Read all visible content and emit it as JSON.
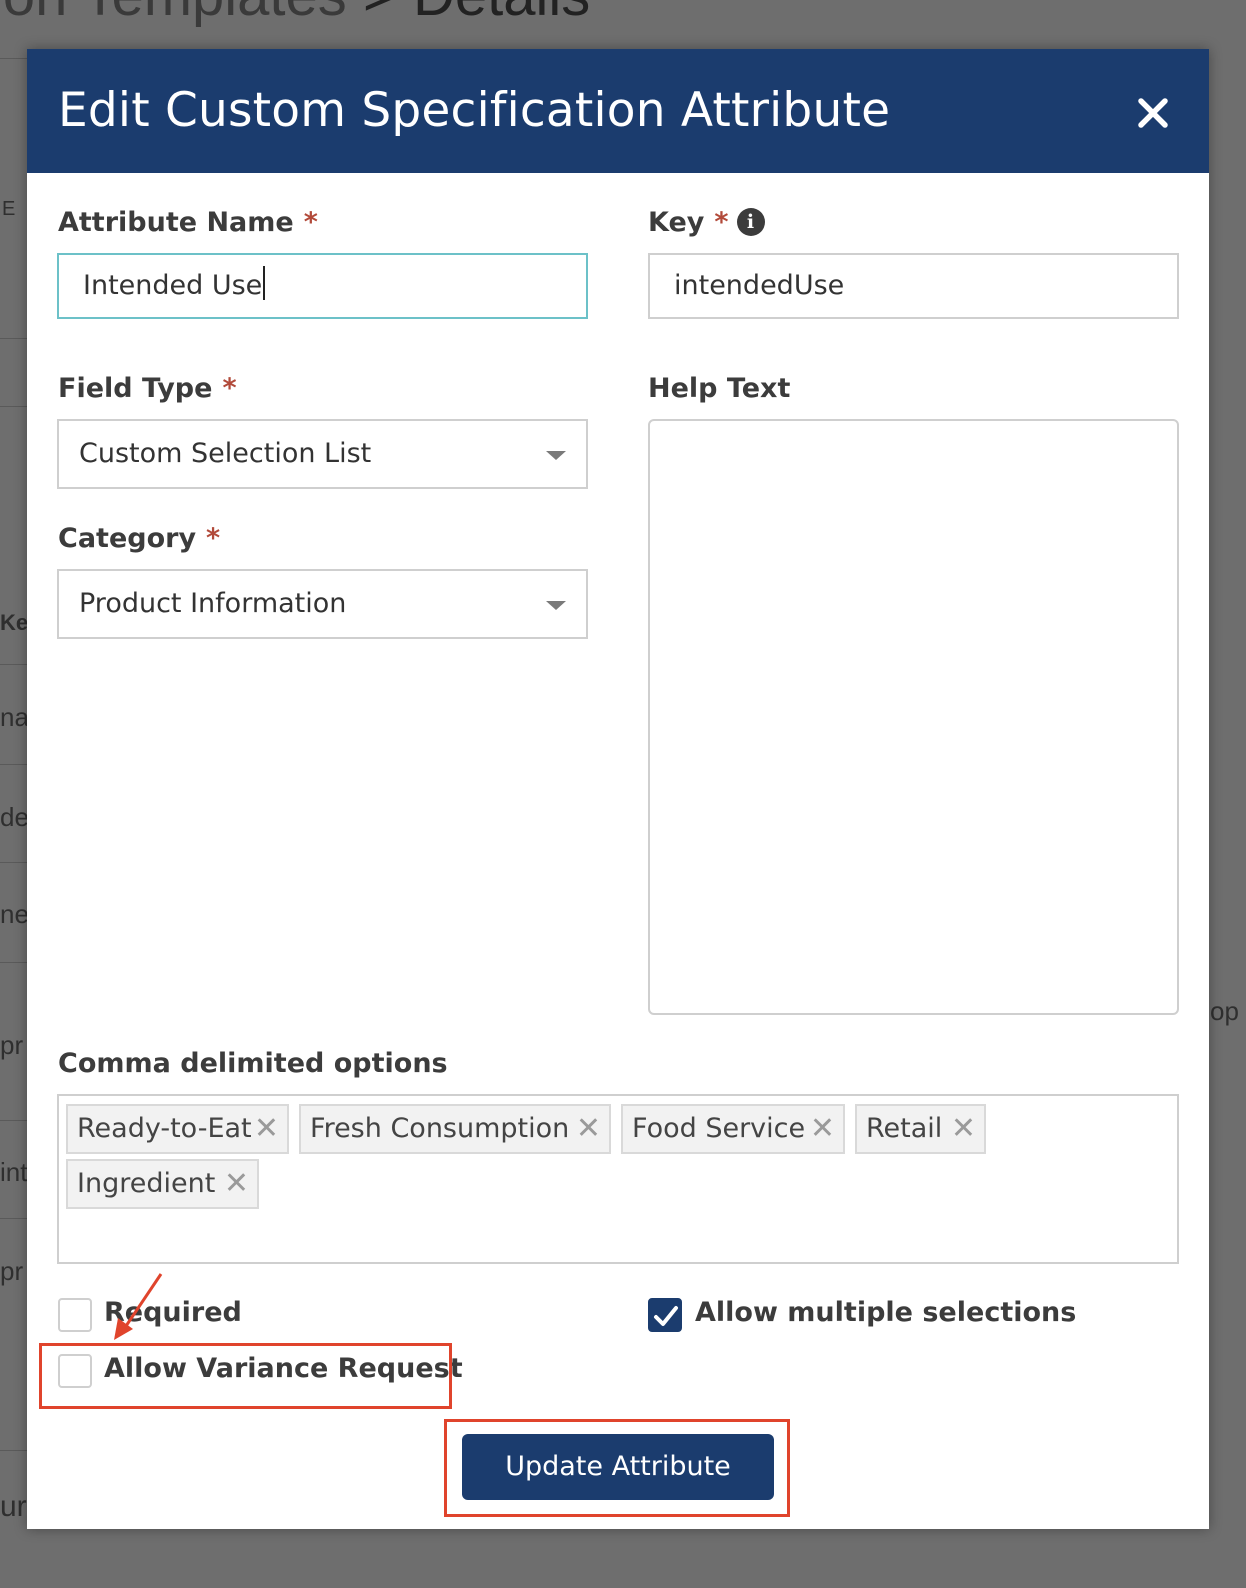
{
  "background": {
    "breadcrumb_left": "ion Templates",
    "breadcrumb_sep": ">",
    "breadcrumb_right": "Details",
    "fragments": [
      "E",
      "Ke",
      "na",
      "de",
      "ne",
      "pr",
      "int",
      "pr",
      "ur"
    ],
    "right_fragment": "op"
  },
  "modal": {
    "title": "Edit Custom Specification Attribute",
    "close_icon": "close-icon",
    "fields": {
      "attribute_name": {
        "label": "Attribute Name",
        "required_mark": "*",
        "value": "Intended Use"
      },
      "key": {
        "label": "Key",
        "required_mark": "*",
        "info_icon": "i",
        "value": "intendedUse"
      },
      "field_type": {
        "label": "Field Type",
        "required_mark": "*",
        "value": "Custom Selection List"
      },
      "help_text": {
        "label": "Help Text",
        "value": ""
      },
      "category": {
        "label": "Category",
        "required_mark": "*",
        "value": "Product Information"
      },
      "options": {
        "label": "Comma delimited options",
        "tags": [
          "Ready-to-Eat",
          "Fresh Consumption",
          "Food Service",
          "Retail",
          "Ingredient"
        ],
        "remove_glyph": "✕"
      }
    },
    "checkboxes": {
      "required": {
        "label": "Required",
        "checked": false
      },
      "allow_multiple": {
        "label": "Allow multiple selections",
        "checked": true
      },
      "allow_variance": {
        "label": "Allow Variance Request",
        "checked": false
      }
    },
    "submit_label": "Update Attribute"
  },
  "colors": {
    "header_bg": "#1b3c6e",
    "required_star": "#b24a3a",
    "focus_border": "#6cc1c8",
    "annotation": "#e0442c"
  }
}
